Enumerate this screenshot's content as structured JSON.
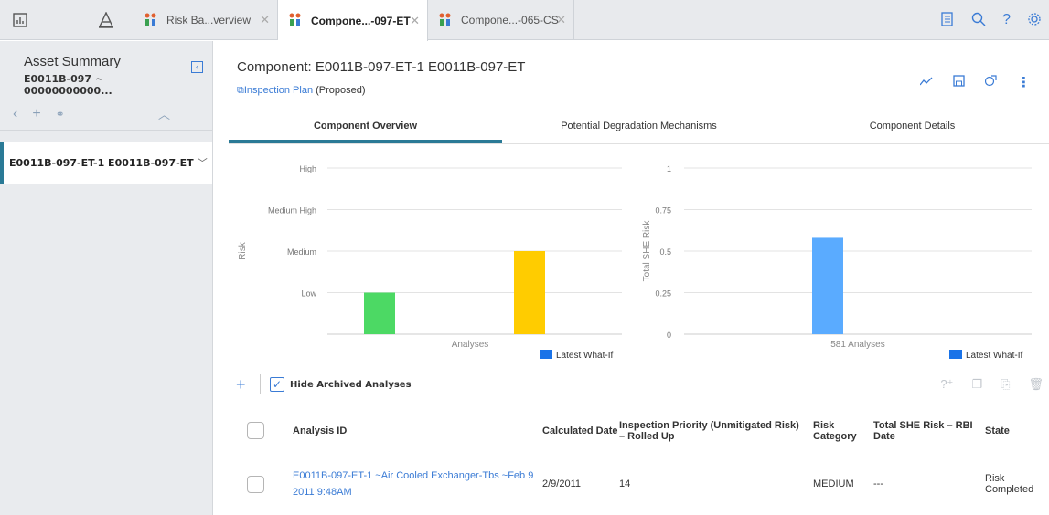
{
  "tabs": [
    {
      "label": "Risk Ba...verview"
    },
    {
      "label": "Compone...-097-ET"
    },
    {
      "label": "Compone...-065-CS"
    }
  ],
  "sidebar": {
    "title": "Asset Summary",
    "subtitle": "E0011B-097 ~ 00000000000...",
    "item": "E0011B-097-ET-1 E0011B-097-ET"
  },
  "header": {
    "title": "Component: E0011B-097-ET-1 E0011B-097-ET",
    "link": "Inspection Plan",
    "status": "(Proposed)"
  },
  "main_tabs": [
    "Component Overview",
    "Potential Degradation Mechanisms",
    "Component Details"
  ],
  "chart_data": [
    {
      "type": "bar",
      "ylabel": "Risk",
      "xlabel": "Analyses",
      "yticks": [
        "Low",
        "Medium",
        "Medium High",
        "High"
      ],
      "ylim": [
        0,
        4
      ],
      "values": [
        1,
        2
      ],
      "colors": [
        "#4cd964",
        "#ffcc00"
      ],
      "legend": "Latest What-If",
      "legend_color": "#1a73e8"
    },
    {
      "type": "bar",
      "ylabel": "Total SHE Risk",
      "xlabel": "581 Analyses",
      "yticks": [
        "0",
        "0.25",
        "0.5",
        "0.75",
        "1"
      ],
      "ylim": [
        0,
        1
      ],
      "values": [
        0.58
      ],
      "colors": [
        "#5aabff"
      ],
      "legend": "Latest What-If",
      "legend_color": "#1a73e8"
    }
  ],
  "grid": {
    "hide_archived": "Hide Archived Analyses",
    "columns": [
      "Analysis ID",
      "Calculated Date",
      "Inspection Priority (Unmitigated Risk) – Rolled Up",
      "Risk Category",
      "Total SHE Risk – RBI Date",
      "State"
    ],
    "rows": [
      {
        "analysis_id": "E0011B-097-ET-1 ~Air Cooled Exchanger-Tbs ~Feb 9 2011 9:48AM",
        "date": "2/9/2011",
        "priority": "14",
        "category": "MEDIUM",
        "she": "---",
        "state": "Risk Completed"
      }
    ]
  }
}
